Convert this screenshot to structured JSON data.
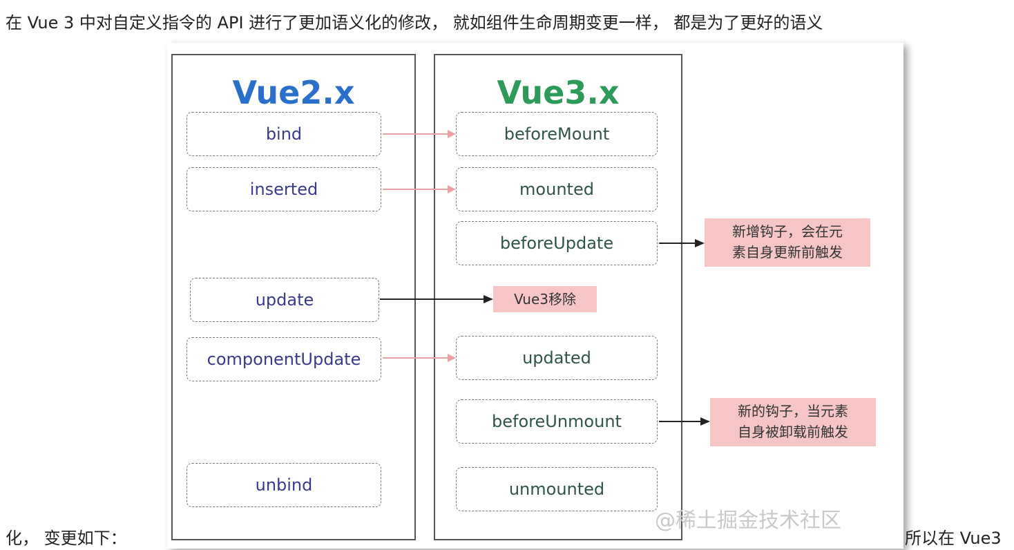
{
  "paragraph": {
    "line1": "在 Vue 3 中对自定义指令的 API 进行了更加语义化的修改， 就如组件生命周期变更一样， 都是为了更好的语义",
    "line2_left": "化， 变更如下：",
    "line2_right": "所以在 Vue3"
  },
  "diagram": {
    "left_title": "Vue2.x",
    "right_title": "Vue3.x",
    "vue2_hooks": [
      "bind",
      "inserted",
      "update",
      "componentUpdate",
      "unbind"
    ],
    "vue3_hooks": [
      "beforeMount",
      "mounted",
      "beforeUpdate",
      "updated",
      "beforeUnmount",
      "unmounted"
    ],
    "notes": {
      "before_update_line1": "新增钩子，会在元",
      "before_update_line2": "素自身更新前触发",
      "removed": "Vue3移除",
      "before_unmount_line1": "新的钩子，当元素",
      "before_unmount_line2": "自身被卸载前触发"
    },
    "watermark": "@稀土掘金技术社区",
    "colors": {
      "vue2_title": "#2a6fc9",
      "vue3_title": "#2e9a5a",
      "mapping_arrow": "#e8a0a0",
      "note_arrow": "#222222",
      "note_bg": "#f6c6c6"
    }
  }
}
